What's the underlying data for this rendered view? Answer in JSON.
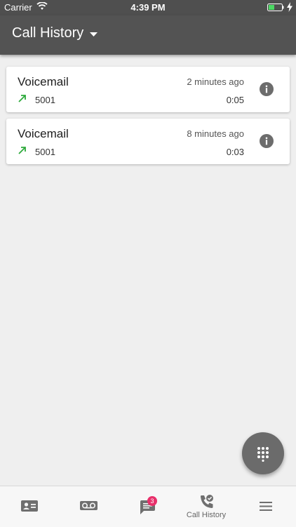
{
  "status_bar": {
    "carrier": "Carrier",
    "time": "4:39 PM"
  },
  "header": {
    "title": "Call History"
  },
  "calls": [
    {
      "name": "Voicemail",
      "time_ago": "2 minutes ago",
      "number": "5001",
      "duration": "0:05"
    },
    {
      "name": "Voicemail",
      "time_ago": "8 minutes ago",
      "number": "5001",
      "duration": "0:03"
    }
  ],
  "bottom_nav": {
    "messages_badge": "3",
    "call_history_label": "Call History"
  },
  "colors": {
    "header": "#535353",
    "outgoing_arrow": "#2eaa3c",
    "badge": "#e8306b",
    "battery": "#4cd964"
  }
}
